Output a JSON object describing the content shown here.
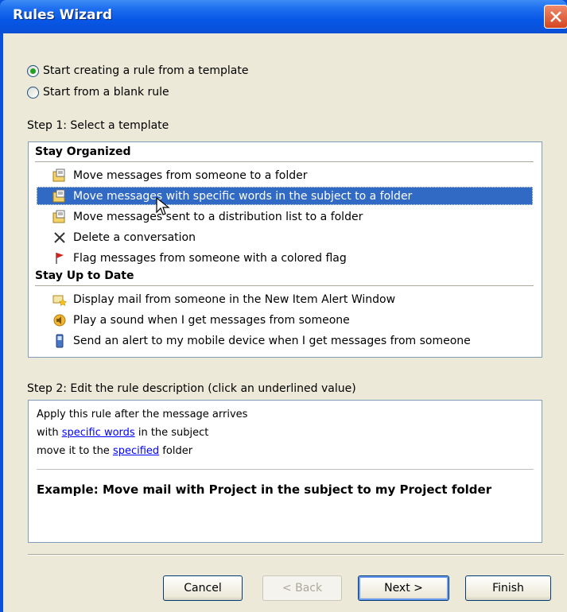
{
  "window": {
    "title": "Rules Wizard"
  },
  "options": [
    {
      "label": "Start creating a rule from a template",
      "checked": true
    },
    {
      "label": "Start from a blank rule",
      "checked": false
    }
  ],
  "step1": {
    "label": "Step 1: Select a template",
    "groups": [
      {
        "title": "Stay Organized"
      },
      {
        "title": "Stay Up to Date"
      }
    ],
    "items": [
      {
        "label": "Move messages from someone to a folder",
        "icon": "folder-move-icon"
      },
      {
        "label": "Move messages with specific words in the subject to a folder",
        "icon": "folder-move-icon",
        "selected": true
      },
      {
        "label": "Move messages sent to a distribution list to a folder",
        "icon": "folder-move-icon"
      },
      {
        "label": "Delete a conversation",
        "icon": "delete-x-icon"
      },
      {
        "label": "Flag messages from someone with a colored flag",
        "icon": "flag-icon"
      },
      {
        "label": "Display mail from someone in the New Item Alert Window",
        "icon": "alert-star-icon"
      },
      {
        "label": "Play a sound when I get messages from someone",
        "icon": "speaker-icon"
      },
      {
        "label": "Send an alert to my mobile device when I get messages from someone",
        "icon": "mobile-icon"
      }
    ]
  },
  "step2": {
    "label": "Step 2: Edit the rule description (click an underlined value)",
    "line1": "Apply this rule after the message arrives",
    "line2_pre": "with ",
    "line2_link": "specific words",
    "line2_post": " in the subject",
    "line3_pre": "move it to the ",
    "line3_link": "specified",
    "line3_post": " folder",
    "example": "Example: Move mail with Project in the subject to my Project folder"
  },
  "buttons": {
    "cancel": "Cancel",
    "back": "< Back",
    "next": "Next >",
    "finish": "Finish"
  },
  "colors": {
    "selection": "#316ac5",
    "link": "#0000ff",
    "titlebar": "#0757e6"
  }
}
